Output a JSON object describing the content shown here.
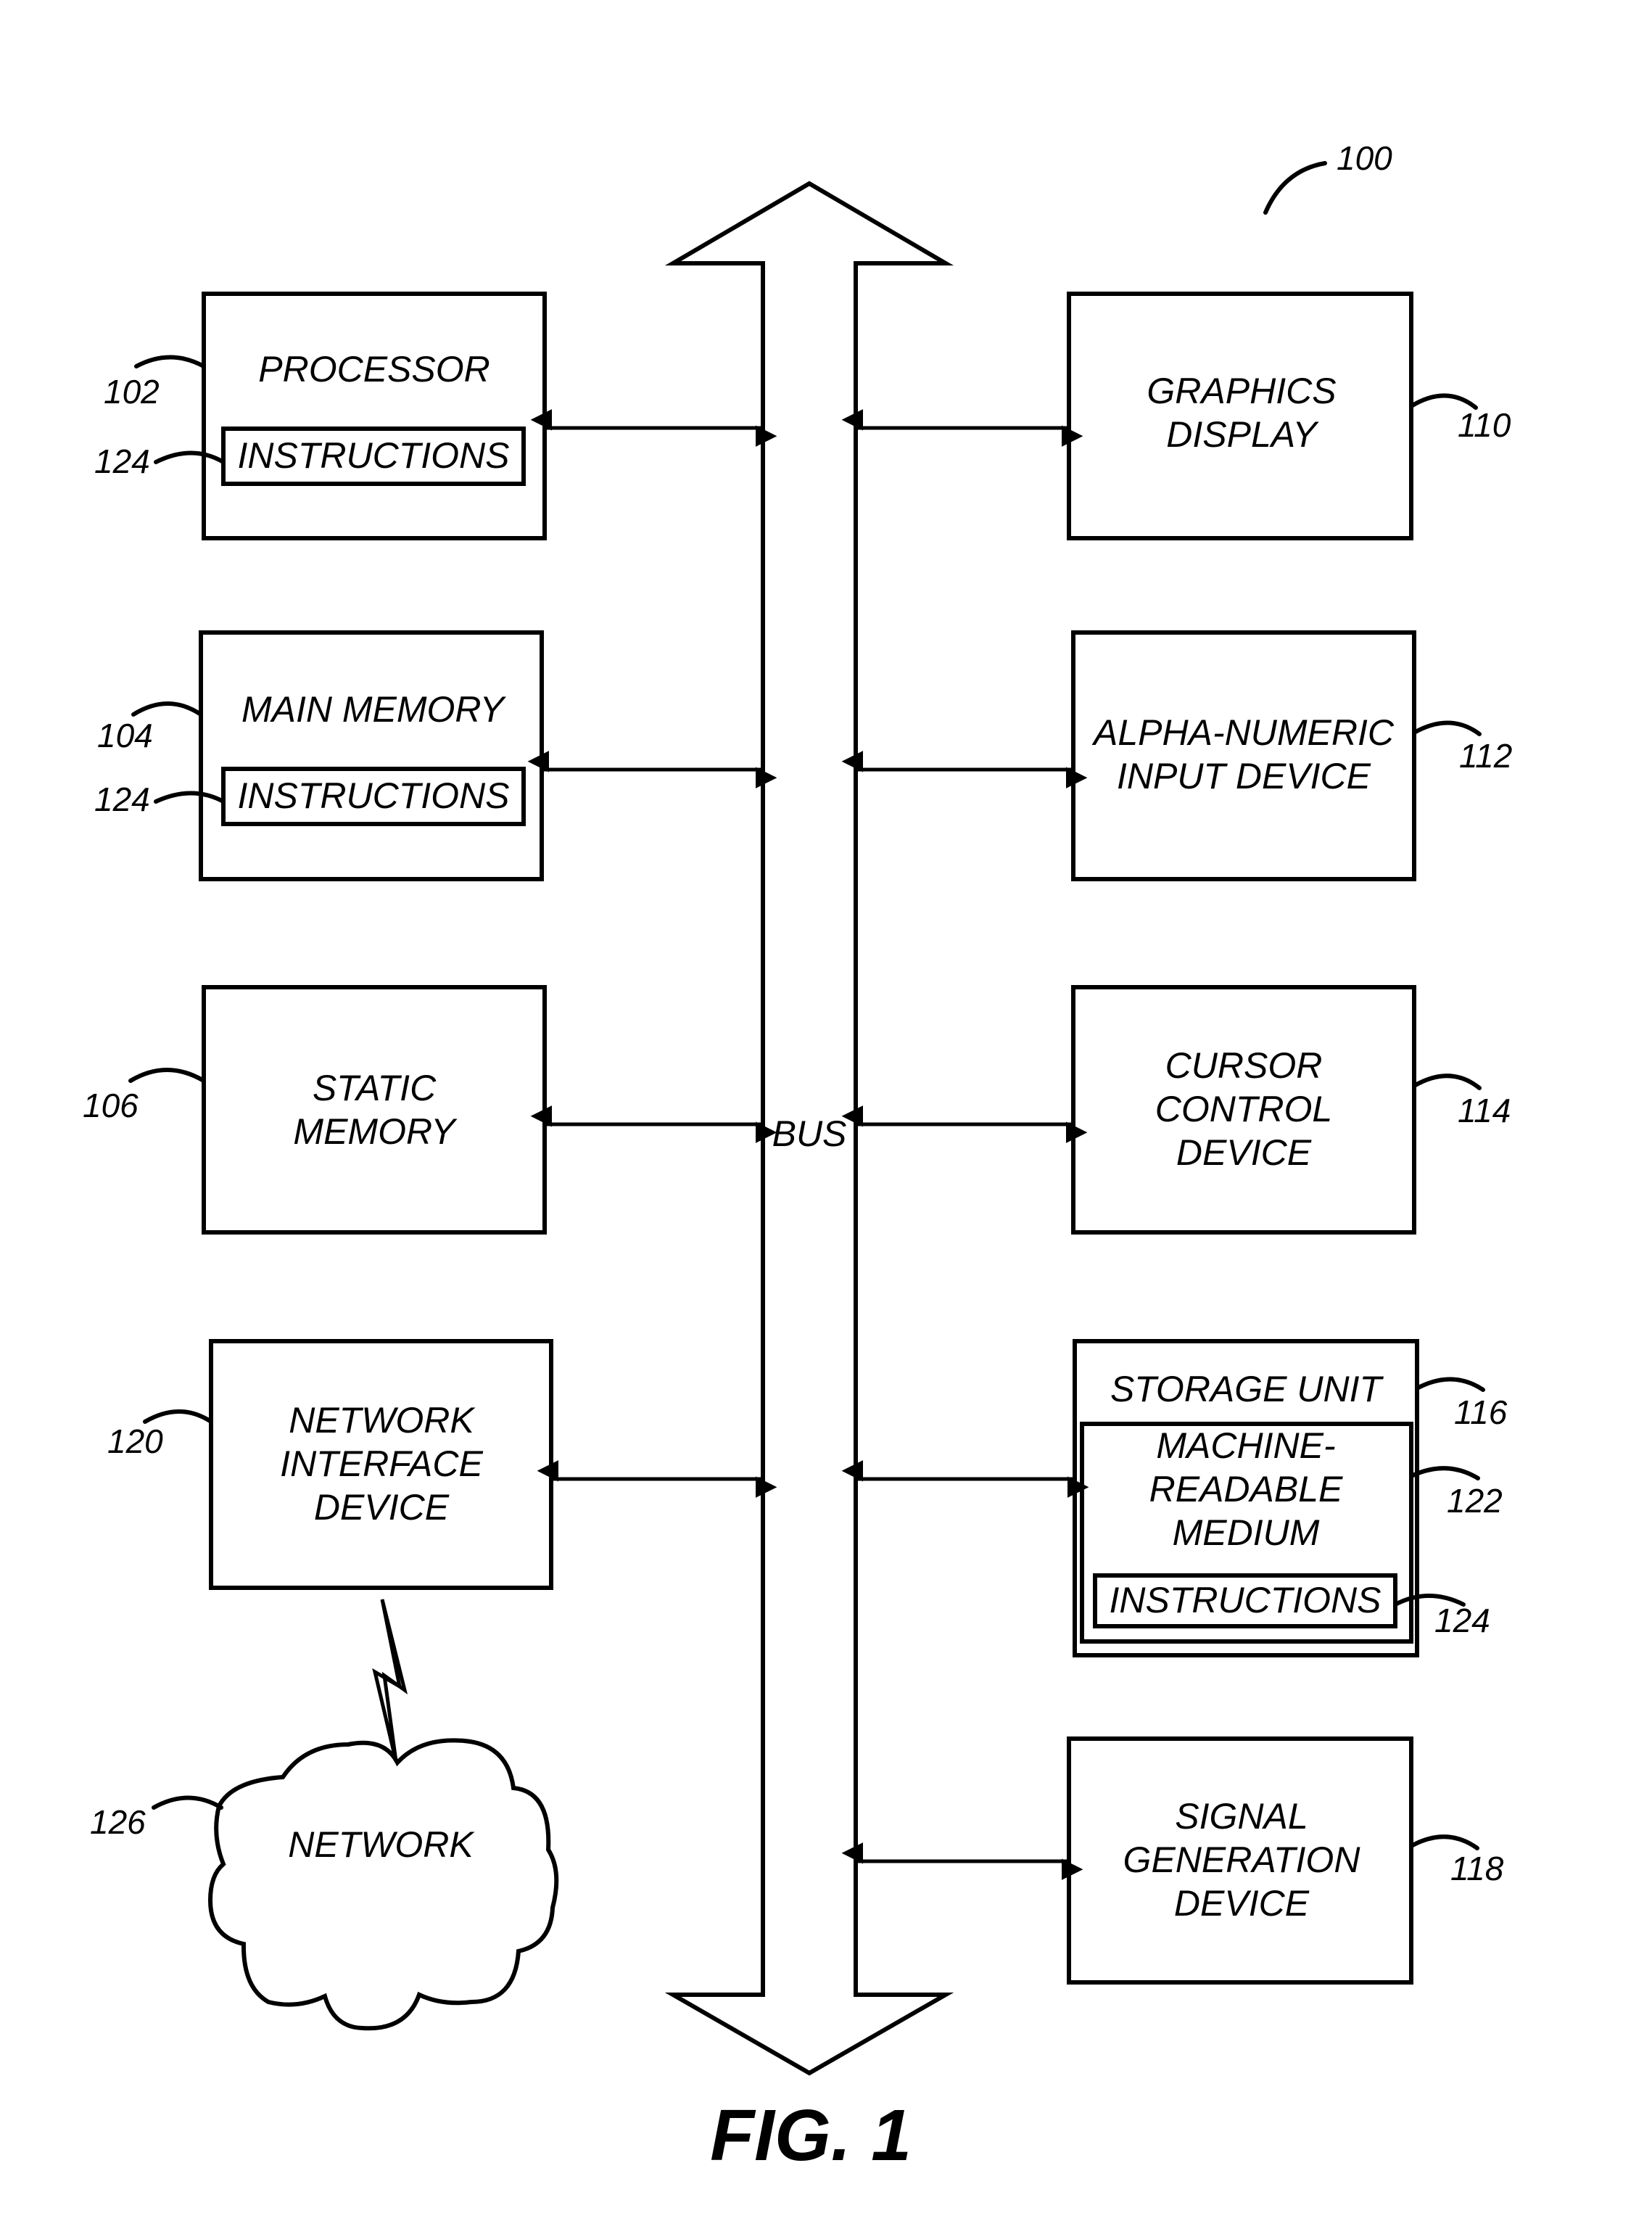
{
  "figure": {
    "caption": "FIG. 1",
    "system_ref": "100",
    "bus_label": "BUS"
  },
  "components": {
    "processor": {
      "lines": [
        "PROCESSOR"
      ],
      "ref": "102",
      "inner": {
        "label": "INSTRUCTIONS",
        "ref": "124"
      }
    },
    "main_memory": {
      "lines": [
        "MAIN MEMORY"
      ],
      "ref": "104",
      "inner": {
        "label": "INSTRUCTIONS",
        "ref": "124"
      }
    },
    "static_memory": {
      "lines": [
        "STATIC",
        "MEMORY"
      ],
      "ref": "106"
    },
    "network_interface": {
      "lines": [
        "NETWORK",
        "INTERFACE",
        "DEVICE"
      ],
      "ref": "120"
    },
    "network": {
      "lines": [
        "NETWORK"
      ],
      "ref": "126"
    },
    "graphics_display": {
      "lines": [
        "GRAPHICS",
        "DISPLAY"
      ],
      "ref": "110"
    },
    "alphanumeric_input": {
      "lines": [
        "ALPHA-NUMERIC",
        "INPUT DEVICE"
      ],
      "ref": "112"
    },
    "cursor_control": {
      "lines": [
        "CURSOR",
        "CONTROL",
        "DEVICE"
      ],
      "ref": "114"
    },
    "storage_unit": {
      "lines": [
        "STORAGE UNIT"
      ],
      "ref": "116",
      "medium": {
        "lines": [
          "MACHINE-",
          "READABLE",
          "MEDIUM"
        ],
        "ref": "122"
      },
      "inner": {
        "label": "INSTRUCTIONS",
        "ref": "124"
      }
    },
    "signal_generation": {
      "lines": [
        "SIGNAL",
        "GENERATION",
        "DEVICE"
      ],
      "ref": "118"
    }
  },
  "connections": [
    {
      "from": "processor",
      "to": "bus",
      "type": "bidirectional"
    },
    {
      "from": "main_memory",
      "to": "bus",
      "type": "bidirectional"
    },
    {
      "from": "static_memory",
      "to": "bus",
      "type": "bidirectional"
    },
    {
      "from": "network_interface",
      "to": "bus",
      "type": "bidirectional"
    },
    {
      "from": "graphics_display",
      "to": "bus",
      "type": "bidirectional"
    },
    {
      "from": "alphanumeric_input",
      "to": "bus",
      "type": "bidirectional"
    },
    {
      "from": "cursor_control",
      "to": "bus",
      "type": "bidirectional"
    },
    {
      "from": "storage_unit",
      "to": "bus",
      "type": "bidirectional"
    },
    {
      "from": "signal_generation",
      "to": "bus",
      "type": "bidirectional"
    },
    {
      "from": "network_interface",
      "to": "network",
      "type": "wireless"
    }
  ]
}
